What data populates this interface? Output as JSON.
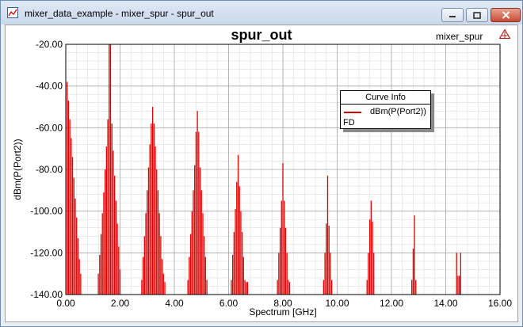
{
  "window": {
    "title": "mixer_data_example - mixer_spur - spur_out",
    "accent": "#c9d9ec"
  },
  "header": {
    "plot_title": "spur_out",
    "design_name": "mixer_spur"
  },
  "legend": {
    "title": "Curve Info",
    "entry": "dBm(P(Port2))",
    "group": "FD"
  },
  "icons": [
    "app-icon",
    "minimize-icon",
    "maximize-icon",
    "close-icon",
    "ansys-logo-icon"
  ],
  "chart_data": {
    "type": "bar",
    "title": "spur_out",
    "xlabel": "Spectrum [GHz]",
    "ylabel": "dBm(P(Port2))",
    "xlim": [
      0,
      16
    ],
    "ylim": [
      -140,
      -20
    ],
    "xticks": [
      "0.00",
      "2.00",
      "4.00",
      "6.00",
      "8.00",
      "10.00",
      "12.00",
      "14.00",
      "16.00"
    ],
    "yticks": [
      "-20.00",
      "-40.00",
      "-60.00",
      "-80.00",
      "-100.00",
      "-120.00",
      "-140.00"
    ],
    "grid": true,
    "legend_position": "upper-right",
    "color": "#e00000",
    "series": [
      {
        "name": "dBm(P(Port2))",
        "x": [
          0.05,
          0.1,
          0.15,
          0.2,
          0.25,
          0.3,
          0.35,
          0.4,
          0.45,
          0.5,
          0.55,
          1.2,
          1.25,
          1.3,
          1.35,
          1.4,
          1.45,
          1.5,
          1.55,
          1.6,
          1.65,
          1.7,
          1.75,
          1.8,
          1.85,
          1.9,
          1.95,
          2.0,
          2.8,
          2.85,
          2.9,
          2.95,
          3.0,
          3.05,
          3.1,
          3.15,
          3.2,
          3.25,
          3.3,
          3.35,
          3.4,
          3.45,
          3.5,
          3.55,
          3.6,
          3.65,
          4.5,
          4.55,
          4.6,
          4.65,
          4.7,
          4.75,
          4.8,
          4.85,
          4.9,
          4.95,
          5.0,
          5.05,
          5.1,
          5.15,
          5.2,
          6.1,
          6.15,
          6.2,
          6.25,
          6.3,
          6.35,
          6.4,
          6.45,
          6.5,
          6.55,
          6.6,
          6.65,
          6.7,
          7.8,
          7.85,
          7.9,
          7.95,
          8.0,
          8.05,
          8.1,
          8.15,
          8.2,
          8.25,
          9.5,
          9.55,
          9.6,
          9.65,
          9.7,
          9.75,
          9.8,
          11.1,
          11.15,
          11.2,
          11.25,
          11.3,
          11.35,
          12.75,
          12.8,
          12.85,
          12.9,
          14.4,
          14.45,
          14.5,
          14.55
        ],
        "y": [
          -38,
          -47,
          -56,
          -65,
          -74,
          -84,
          -94,
          -103,
          -113,
          -123,
          -130,
          -130,
          -121,
          -111,
          -101,
          -91,
          -80,
          -69,
          -56,
          -20,
          -20,
          -58,
          -71,
          -83,
          -95,
          -106,
          -117,
          -128,
          -133,
          -122,
          -112,
          -101,
          -90,
          -79,
          -68,
          -58,
          -50,
          -58,
          -69,
          -80,
          -90,
          -101,
          -112,
          -123,
          -130,
          -134,
          -133,
          -122,
          -111,
          -100,
          -90,
          -78,
          -62,
          -52,
          -62,
          -79,
          -90,
          -101,
          -112,
          -122,
          -133,
          -133,
          -121,
          -110,
          -99,
          -86,
          -73,
          -88,
          -100,
          -110,
          -122,
          -133,
          -134,
          -134,
          -133,
          -120,
          -108,
          -95,
          -77,
          -95,
          -108,
          -120,
          -133,
          -134,
          -133,
          -120,
          -106,
          -83,
          -107,
          -120,
          -133,
          -133,
          -120,
          -104,
          -95,
          -105,
          -120,
          -133,
          -118,
          -102,
          -133,
          -120,
          -131,
          -131,
          -120
        ]
      }
    ]
  }
}
